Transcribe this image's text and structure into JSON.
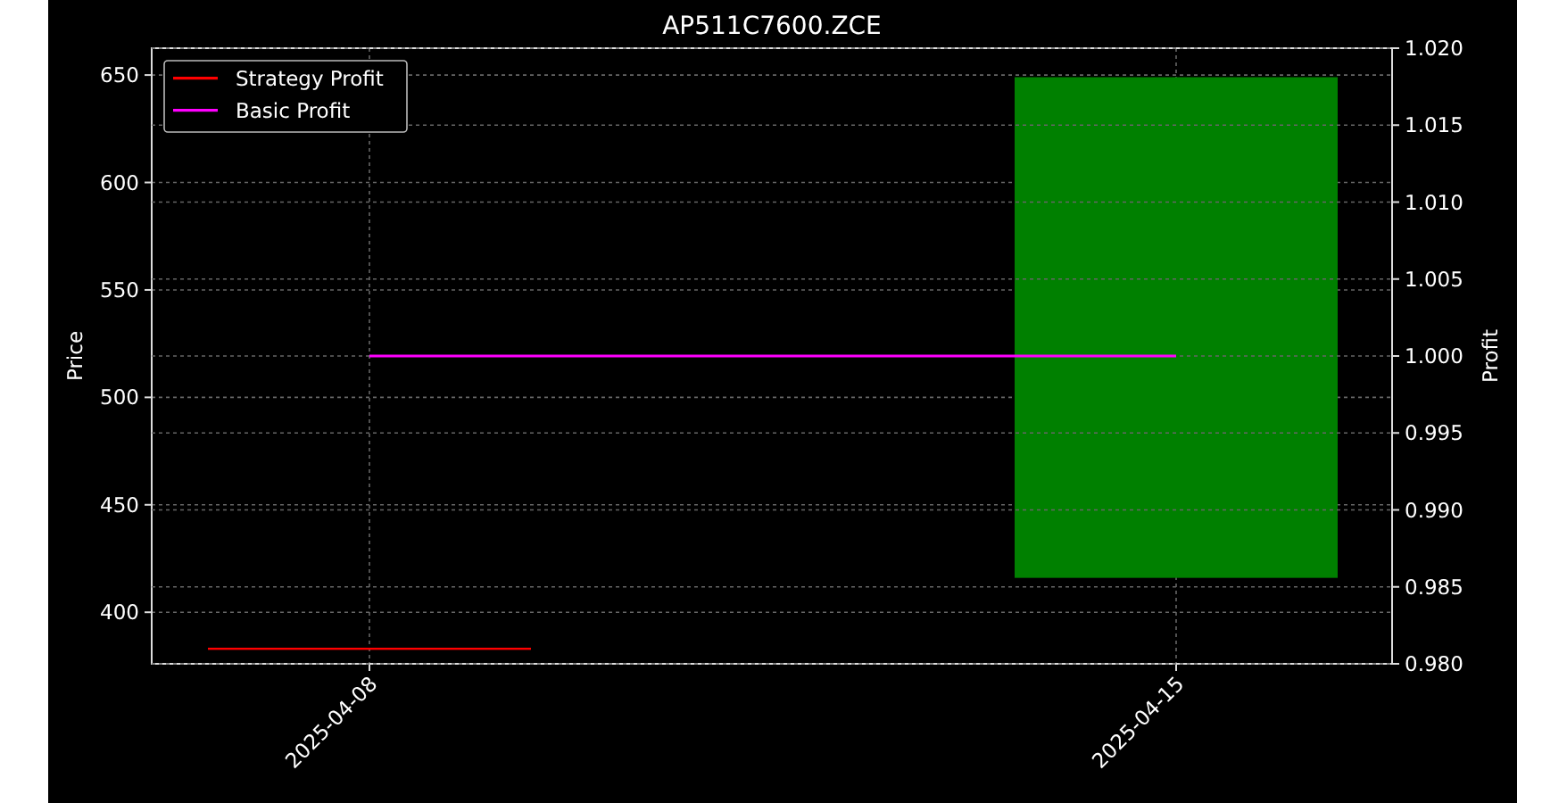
{
  "chart": {
    "chart_data": {
      "type": "candlestick",
      "title": "AP511C7600.ZCE",
      "ylabel": "Price",
      "categories": [
        "2025-04-08",
        "2025-04-15"
      ],
      "grid": true,
      "ylim": [
        376,
        662.5
      ],
      "yticks": [
        400,
        450,
        500,
        550,
        600,
        650
      ],
      "series": [
        {
          "name": "Strategy Profit",
          "color": "#ff0000",
          "colors": [
            "#ff0000",
            "#008000"
          ],
          "ohlc": [
            [
              383,
              383,
              383,
              383
            ],
            [
              416,
              649,
              416,
              649
            ]
          ]
        }
      ]
    }
  },
  "profit_chart": {
    "chart_data": {
      "type": "line",
      "ylabel": "Profit",
      "grid": true,
      "ylim": [
        0.98,
        1.02
      ],
      "yticks": [
        {
          "value": 0.98,
          "label": "0.980"
        },
        {
          "value": 0.985,
          "label": "0.985"
        },
        {
          "value": 0.99,
          "label": "0.990"
        },
        {
          "value": 0.995,
          "label": "0.995"
        },
        {
          "value": 1.0,
          "label": "1.000"
        },
        {
          "value": 1.005,
          "label": "1.005"
        },
        {
          "value": 1.01,
          "label": "1.010"
        },
        {
          "value": 1.015,
          "label": "1.015"
        },
        {
          "value": 1.02,
          "label": "1.020"
        }
      ],
      "series": [
        {
          "name": "Basic Profit",
          "color": "#ff00ff",
          "values": [
            1.0,
            1.0
          ]
        }
      ]
    }
  }
}
